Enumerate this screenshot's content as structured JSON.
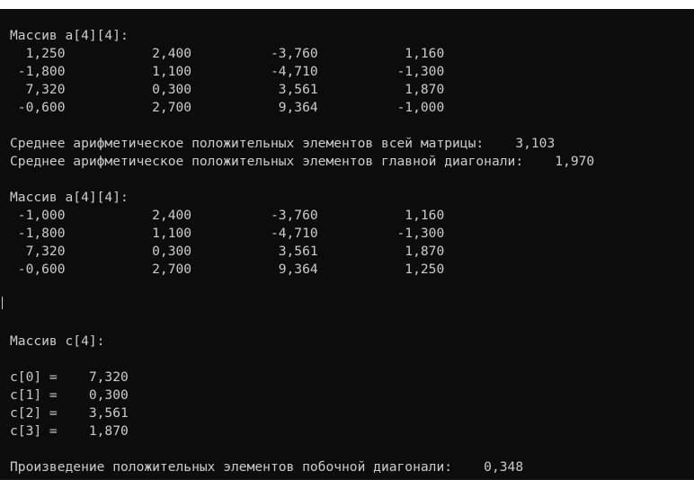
{
  "console": {
    "lines": [
      "Массив a[4][4]:",
      "  1,250           2,400          -3,760           1,160",
      " -1,800           1,100          -4,710          -1,300",
      "  7,320           0,300           3,561           1,870",
      " -0,600           2,700           9,364          -1,000",
      "",
      "Среднее арифметическое положительных элементов всей матрицы:    3,103",
      "Среднее арифметическое положительных элементов главной диагонали:    1,970",
      "",
      "Массив a[4][4]:",
      " -1,000           2,400          -3,760           1,160",
      " -1,800           1,100          -4,710          -1,300",
      "  7,320           0,300           3,561           1,870",
      " -0,600           2,700           9,364           1,250",
      "",
      "",
      "",
      "Массив c[4]:",
      "",
      "c[0] =    7,320",
      "c[1] =    0,300",
      "c[2] =    3,561",
      "c[3] =    1,870",
      "",
      "Произведение положительных элементов побочной диагонали:    0,348"
    ]
  },
  "colors": {
    "background": "#0c0c0c",
    "text": "#cccccc"
  }
}
